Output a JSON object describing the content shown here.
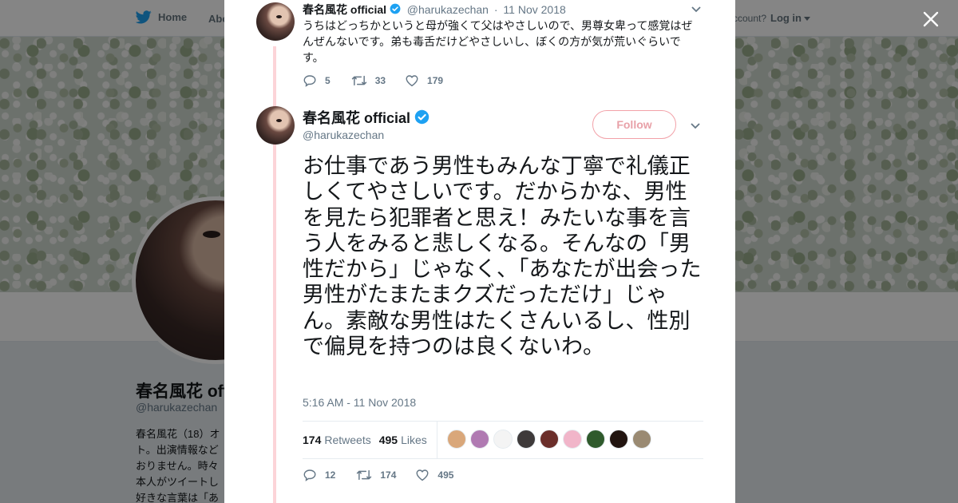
{
  "topnav": {
    "home_label": "Home",
    "about_label": "Abo",
    "account_text": "ccount?",
    "login_label": "Log in"
  },
  "profile": {
    "name": "春名風花 off",
    "handle": "@harukazechan",
    "bio_lines": [
      "春名風花（18）オ",
      "ト。出演情報など",
      "おりません。時々",
      "本人がツイートし",
      "好きな言葉は「あ"
    ]
  },
  "prev_tweet": {
    "name": "春名風花 official",
    "handle": "@harukazechan",
    "dot": "·",
    "date": "11 Nov 2018",
    "text": "うちはどっちかというと母が強くて父はやさしいので、男尊女卑って感覚はぜんぜんないです。弟も毒舌だけどやさしいし、ぼくの方が気が荒いぐらいです。",
    "replies": "5",
    "retweets": "33",
    "likes": "179"
  },
  "tweet": {
    "name": "春名風花 official",
    "handle": "@harukazechan",
    "follow_label": "Follow",
    "text": "お仕事であう男性もみんな丁寧で礼儀正しくてやさしいです。だからかな、男性を見たら犯罪者と思え！みたいな事を言う人をみると悲しくなる。そんなの「男性だから」じゃなく、「あなたが出会った男性がたまたまクズだっただけ」じゃん。素敵な男性はたくさんいるし、性別で偏見を持つのは良くないわ。",
    "timestamp": "5:16 AM - 11 Nov 2018",
    "retweet_count": "174",
    "retweet_label": "Retweets",
    "like_count": "495",
    "like_label": "Likes",
    "replies": "12",
    "retweets": "174",
    "likes": "495"
  },
  "likers": [
    {
      "color": "#d9a77a"
    },
    {
      "color": "#b07ab2"
    },
    {
      "color": "#f4f4f4"
    },
    {
      "color": "#3e3a3a"
    },
    {
      "color": "#6b2e2a"
    },
    {
      "color": "#f1b5c9"
    },
    {
      "color": "#2f5a2c"
    },
    {
      "color": "#221510"
    },
    {
      "color": "#9a8a72"
    }
  ],
  "icons": {
    "bird": "twitter-bird-icon",
    "close": "close-icon",
    "verified": "verified-badge-icon",
    "chevron": "chevron-down-icon",
    "reply": "reply-icon",
    "retweet": "retweet-icon",
    "like": "heart-icon"
  },
  "colors": {
    "thread_line": "#fcd4d8",
    "follow_border": "#f2a1a8",
    "verified": "#1da1f2",
    "muted": "#657786"
  }
}
